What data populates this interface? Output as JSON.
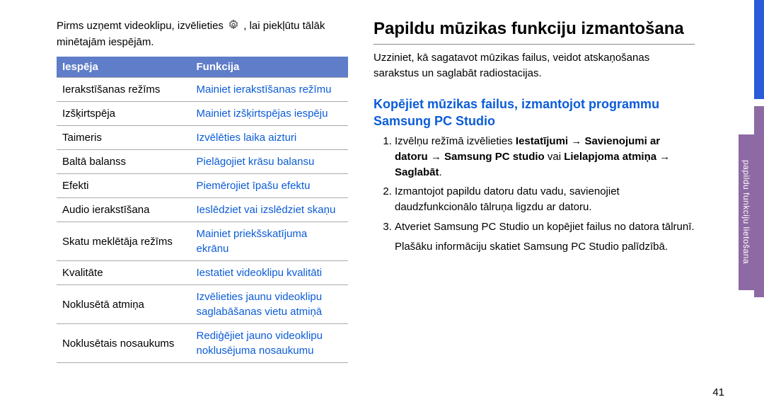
{
  "intro": {
    "before_icon": "Pirms uzņemt videoklipu, izvēlieties ",
    "after_icon": ", lai piekļūtu tālāk minētajām iespējām."
  },
  "table": {
    "headers": {
      "option": "Iespēja",
      "function": "Funkcija"
    },
    "rows": [
      {
        "o": "Ierakstīšanas režīms",
        "f": "Mainiet ierakstīšanas režīmu"
      },
      {
        "o": "Izšķirtspēja",
        "f": "Mainiet izšķirtspējas iespēju"
      },
      {
        "o": "Taimeris",
        "f": "Izvēlēties laika aizturi"
      },
      {
        "o": "Baltā balanss",
        "f": "Pielāgojiet krāsu balansu"
      },
      {
        "o": "Efekti",
        "f": "Piemērojiet īpašu efektu"
      },
      {
        "o": "Audio ierakstīšana",
        "f": "Ieslēdziet vai izslēdziet skaņu"
      },
      {
        "o": "Skatu meklētāja režīms",
        "f": "Mainiet priekšskatījuma ekrānu"
      },
      {
        "o": "Kvalitāte",
        "f": "Iestatiet videoklipu kvalitāti"
      },
      {
        "o": "Noklusētā atmiņa",
        "f": "Izvēlieties jaunu videoklipu saglabāšanas vietu atmiņā"
      },
      {
        "o": "Noklusētais nosaukums",
        "f": "Rediģējiet jauno videoklipu noklusējuma nosaukumu"
      }
    ]
  },
  "right": {
    "heading": "Papildu mūzikas funkciju izmantošana",
    "para": "Uzziniet, kā sagatavot mūzikas failus, veidot atskaņošanas sarakstus un saglabāt radiostacijas.",
    "sub": "Kopējiet mūzikas failus, izmantojot programmu Samsung PC Studio",
    "step1": {
      "a": "Izvēlņu režīmā izvēlieties ",
      "b": "Iestatījumi",
      "c": " → ",
      "d": "Savienojumi ar datoru",
      "e": " → ",
      "f": "Samsung PC studio",
      "g": " vai ",
      "h": "Lielapjoma atmiņa",
      "i": " → ",
      "j": "Saglabāt",
      "k": "."
    },
    "step2": "Izmantojot papildu datoru datu vadu, savienojiet daudzfunkcionālo tālruņa ligzdu ar datoru.",
    "step3": "Atveriet Samsung PC Studio un kopējiet failus no datora tālrunī.",
    "after": "Plašāku informāciju skatiet Samsung PC Studio palīdzībā."
  },
  "side_tab": "papildu funkciju lietošana",
  "page": "41"
}
